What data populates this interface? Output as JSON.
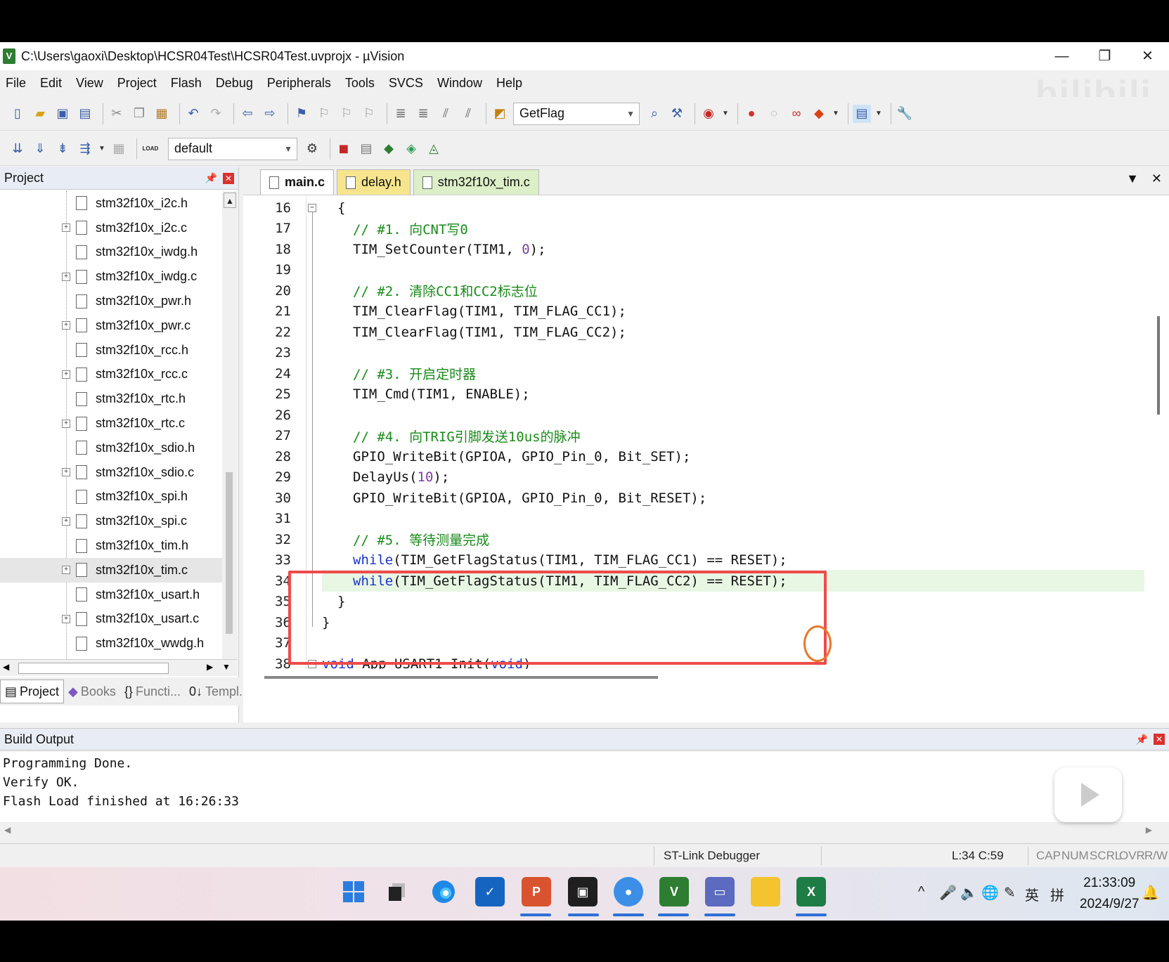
{
  "window": {
    "title": "C:\\Users\\gaoxi\\Desktop\\HCSR04Test\\HCSR04Test.uvprojx - µVision",
    "minimize": "—",
    "restore": "❐",
    "close": "✕"
  },
  "menu": [
    "File",
    "Edit",
    "View",
    "Project",
    "Flash",
    "Debug",
    "Peripherals",
    "Tools",
    "SVCS",
    "Window",
    "Help"
  ],
  "watermark": "bilibili",
  "toolbar": {
    "find_combo": "GetFlag",
    "target_combo": "default",
    "load_label": "LOAD"
  },
  "project_panel": {
    "title": "Project",
    "files": [
      {
        "name": "stm32f10x_i2c.h",
        "expandable": false
      },
      {
        "name": "stm32f10x_i2c.c",
        "expandable": true
      },
      {
        "name": "stm32f10x_iwdg.h",
        "expandable": false
      },
      {
        "name": "stm32f10x_iwdg.c",
        "expandable": true
      },
      {
        "name": "stm32f10x_pwr.h",
        "expandable": false
      },
      {
        "name": "stm32f10x_pwr.c",
        "expandable": true
      },
      {
        "name": "stm32f10x_rcc.h",
        "expandable": false
      },
      {
        "name": "stm32f10x_rcc.c",
        "expandable": true
      },
      {
        "name": "stm32f10x_rtc.h",
        "expandable": false
      },
      {
        "name": "stm32f10x_rtc.c",
        "expandable": true
      },
      {
        "name": "stm32f10x_sdio.h",
        "expandable": false
      },
      {
        "name": "stm32f10x_sdio.c",
        "expandable": true
      },
      {
        "name": "stm32f10x_spi.h",
        "expandable": false
      },
      {
        "name": "stm32f10x_spi.c",
        "expandable": true
      },
      {
        "name": "stm32f10x_tim.h",
        "expandable": false
      },
      {
        "name": "stm32f10x_tim.c",
        "expandable": true,
        "selected": true
      },
      {
        "name": "stm32f10x_usart.h",
        "expandable": false
      },
      {
        "name": "stm32f10x_usart.c",
        "expandable": true
      },
      {
        "name": "stm32f10x_wwdg.h",
        "expandable": false
      },
      {
        "name": "stm32f10x_wwdg.c",
        "expandable": true
      }
    ],
    "tabs": [
      {
        "label": "Project",
        "icon": "project-icon"
      },
      {
        "label": "Books",
        "icon": "books-icon"
      },
      {
        "label": "Functi...",
        "icon": "functions-icon"
      },
      {
        "label": "Templ...",
        "icon": "templates-icon"
      }
    ]
  },
  "editor": {
    "tabs": [
      {
        "label": "main.c",
        "style": "active"
      },
      {
        "label": "delay.h",
        "style": "yellow"
      },
      {
        "label": "stm32f10x_tim.c",
        "style": "green"
      }
    ],
    "lines": [
      {
        "no": "16",
        "text": "{",
        "indent": 1,
        "kind": "plain",
        "fold": "open"
      },
      {
        "no": "17",
        "text": "// #1. 向CNT写0",
        "indent": 2,
        "kind": "comment"
      },
      {
        "no": "18",
        "text": "TIM_SetCounter(TIM1, 0);",
        "indent": 2,
        "kind": "code-num",
        "pre": "TIM_SetCounter(TIM1, ",
        "num": "0",
        "post": ");"
      },
      {
        "no": "19",
        "text": "",
        "indent": 2,
        "kind": "plain"
      },
      {
        "no": "20",
        "text": "// #2. 清除CC1和CC2标志位",
        "indent": 2,
        "kind": "comment"
      },
      {
        "no": "21",
        "text": "TIM_ClearFlag(TIM1, TIM_FLAG_CC1);",
        "indent": 2,
        "kind": "plain"
      },
      {
        "no": "22",
        "text": "TIM_ClearFlag(TIM1, TIM_FLAG_CC2);",
        "indent": 2,
        "kind": "plain"
      },
      {
        "no": "23",
        "text": "",
        "indent": 2,
        "kind": "plain"
      },
      {
        "no": "24",
        "text": "// #3. 开启定时器",
        "indent": 2,
        "kind": "comment"
      },
      {
        "no": "25",
        "text": "TIM_Cmd(TIM1, ENABLE);",
        "indent": 2,
        "kind": "plain"
      },
      {
        "no": "26",
        "text": "",
        "indent": 2,
        "kind": "plain"
      },
      {
        "no": "27",
        "text": "// #4. 向TRIG引脚发送10us的脉冲",
        "indent": 2,
        "kind": "comment"
      },
      {
        "no": "28",
        "text": "GPIO_WriteBit(GPIOA, GPIO_Pin_0, Bit_SET);",
        "indent": 2,
        "kind": "plain"
      },
      {
        "no": "29",
        "text": "DelayUs(10);",
        "indent": 2,
        "kind": "code-num",
        "pre": "DelayUs(",
        "num": "10",
        "post": ");"
      },
      {
        "no": "30",
        "text": "GPIO_WriteBit(GPIOA, GPIO_Pin_0, Bit_RESET);",
        "indent": 2,
        "kind": "plain"
      },
      {
        "no": "31",
        "text": "",
        "indent": 2,
        "kind": "plain"
      },
      {
        "no": "32",
        "text": "// #5. 等待测量完成",
        "indent": 2,
        "kind": "comment"
      },
      {
        "no": "33",
        "text": "while(TIM_GetFlagStatus(TIM1, TIM_FLAG_CC1) == RESET);",
        "indent": 2,
        "kind": "while",
        "kw": "while",
        "rest": "(TIM_GetFlagStatus(TIM1, TIM_FLAG_CC1) == RESET);"
      },
      {
        "no": "34",
        "text": "while(TIM_GetFlagStatus(TIM1, TIM_FLAG_CC2) == RESET);",
        "indent": 2,
        "kind": "while",
        "kw": "while",
        "rest": "(TIM_GetFlagStatus(TIM1, TIM_FLAG_CC2) == RESET);",
        "current": true
      },
      {
        "no": "35",
        "text": "}",
        "indent": 1,
        "kind": "plain"
      },
      {
        "no": "36",
        "text": "}",
        "indent": 0,
        "kind": "plain"
      },
      {
        "no": "37",
        "text": "",
        "indent": 0,
        "kind": "plain"
      },
      {
        "no": "38",
        "text": "void App_USART1_Init(void)",
        "indent": 0,
        "kind": "void",
        "kw": "void",
        "rest": " App_USART1_Init(",
        "kw2": "void",
        "post": ")",
        "fold": "open"
      }
    ]
  },
  "build_output": {
    "title": "Build Output",
    "lines": [
      "Programming Done.",
      "Verify OK.",
      "Flash Load finished at 16:26:33"
    ]
  },
  "statusbar": {
    "debugger": "ST-Link Debugger",
    "position": "L:34 C:59",
    "indicators": [
      "CAP",
      "NUM",
      "SCRL",
      "OVR",
      "R/W"
    ]
  },
  "taskbar": {
    "apps": [
      "start-icon",
      "task-view-icon",
      "edge-icon",
      "whiteboard-icon",
      "powerpoint-icon",
      "camera-app-icon",
      "meeting-app-icon",
      "keil-uvision-icon",
      "device-manager-icon",
      "file-explorer-icon",
      "excel-icon"
    ],
    "tray": {
      "chevron": "^",
      "ime_lang": "英",
      "ime_mode": "拼"
    },
    "clock_time": "21:33:09",
    "clock_date": "2024/9/27"
  },
  "colors": {
    "comment": "#1a8a1a",
    "keyword": "#1a33c8",
    "number": "#7a3fa0",
    "current_line": "#e8f6e4",
    "highlight_box": "#ee4b4b",
    "cursor_circle": "#e8772c"
  }
}
